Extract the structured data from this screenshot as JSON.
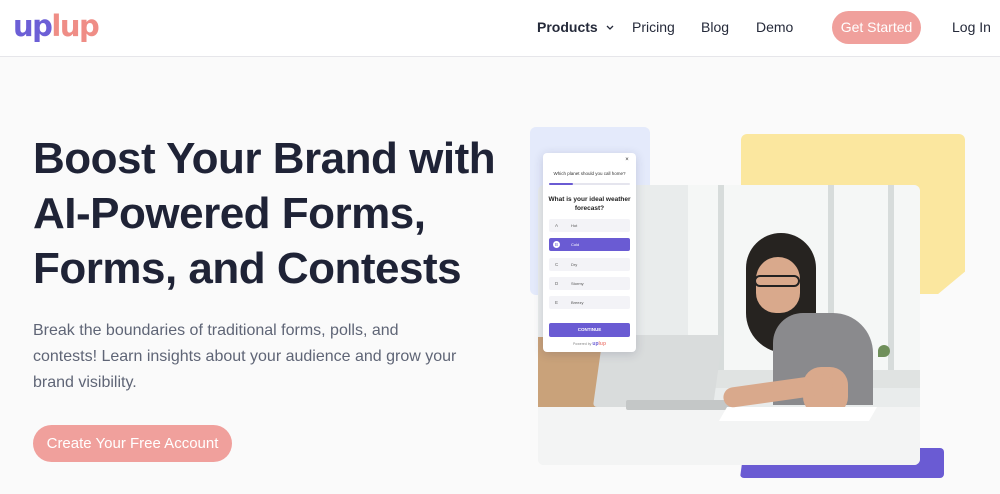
{
  "brand": {
    "logo_part1": "up",
    "logo_part2": "lup",
    "primary": "#6c5fd6",
    "accent": "#f0a09c"
  },
  "nav": {
    "products": "Products",
    "products_icon": "chevron-down-icon",
    "pricing": "Pricing",
    "blog": "Blog",
    "demo": "Demo",
    "get_started": "Get Started",
    "login": "Log In"
  },
  "hero": {
    "title_lines": [
      "Boost Your Brand with",
      "AI-Powered Forms,",
      "Forms, and Contests"
    ],
    "subtitle_lines": [
      "Break the boundaries of traditional forms, polls, and",
      "contests! Learn insights about your audience and grow your",
      "brand visibility."
    ],
    "cta": "Create Your Free Account"
  },
  "form_card": {
    "close": "×",
    "question1": "Which planet should you call home?",
    "progress": 0.3,
    "question2_lines": [
      "What is your ideal weather",
      "forecast?"
    ],
    "options": [
      {
        "key": "A",
        "label": "Hot",
        "selected": false
      },
      {
        "key": "B",
        "label": "Cold",
        "selected": true
      },
      {
        "key": "C",
        "label": "Dry",
        "selected": false
      },
      {
        "key": "D",
        "label": "Stormy",
        "selected": false
      },
      {
        "key": "E",
        "label": "Breezy",
        "selected": false
      }
    ],
    "continue": "CONTINUE",
    "powered_by": "Powered by",
    "powered_logo_part1": "up",
    "powered_logo_part2": "lup"
  }
}
